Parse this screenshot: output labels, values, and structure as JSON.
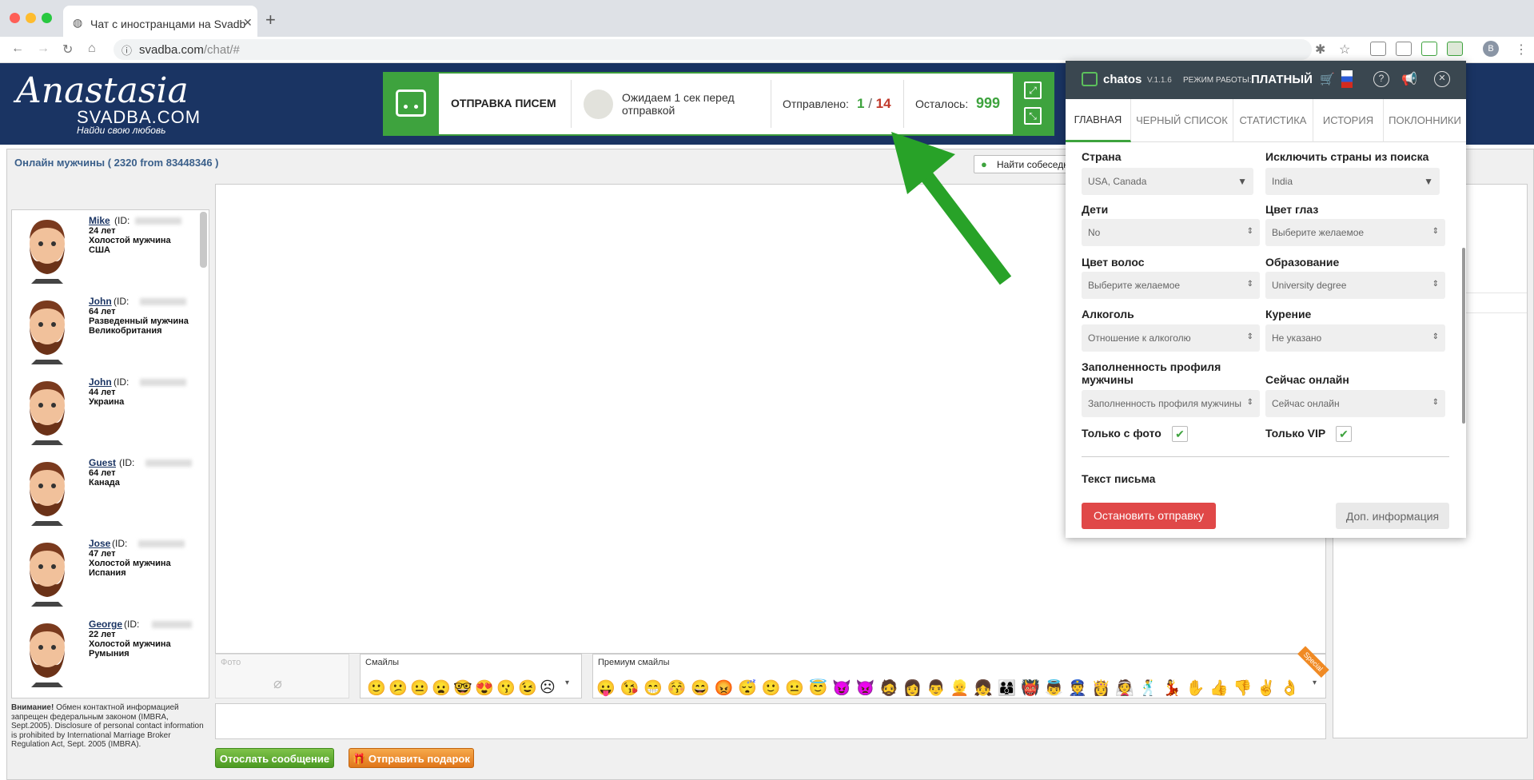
{
  "browser": {
    "tab_title": "Чат с иностранцами на Svadb",
    "url_host": "svadba.com",
    "url_path": "/chat/#",
    "profile_letter": "B"
  },
  "site": {
    "logo_script": "Anastasia",
    "logo_name": "SVADBA.COM",
    "logo_tagline": "Найди свою любовь"
  },
  "status_bar": {
    "title": "ОТПРАВКА ПИСЕМ",
    "waiting": "Ожидаем 1 сек перед отправкой",
    "sent_label": "Отправлено:",
    "sent_current": "1",
    "sent_sep": "/",
    "sent_total": "14",
    "left_label": "Осталось:",
    "left_value": "999"
  },
  "online": {
    "title": "Онлайн мужчины ( 2320 from 83448346 )",
    "find_button": "Найти собеседн"
  },
  "users": [
    {
      "name": "Mike",
      "id_label": "(ID: ",
      "age": "24 лет",
      "status": "Холостой мужчина",
      "country": "США"
    },
    {
      "name": "John",
      "id_label": " (ID: ",
      "age": "64 лет",
      "status": "Разведенный мужчина",
      "country": "Великобритания"
    },
    {
      "name": "John",
      "id_label": " (ID: ",
      "age": "44 лет",
      "status": "",
      "country": "Украина"
    },
    {
      "name": "Guest",
      "id_label": " (ID: ",
      "age": "64 лет",
      "status": "",
      "country": "Канада"
    },
    {
      "name": "Jose",
      "id_label": " (ID: ",
      "age": "47 лет",
      "status": "Холостой мужчина",
      "country": "Испания"
    },
    {
      "name": "George",
      "id_label": " (ID: ",
      "age": "22 лет",
      "status": "Холостой мужчина",
      "country": "Румыния"
    }
  ],
  "composer": {
    "photo_label": "Фото",
    "smiles_label": "Смайлы",
    "premium_label": "Премиум смайлы",
    "special_badge": "Special",
    "warning_bold": "Внимание!",
    "warning_text": " Обмен контактной информацией запрещен федеральным законом (IMBRA, Sept.2005). Disclosure of personal contact information is prohibited by International Marriage Broker Regulation Act, Sept. 2005 (IMBRA).",
    "send_button": "Отослать сообщение",
    "gift_button": "Отправить подарок",
    "smiles": [
      "🙂",
      "😕",
      "😐",
      "😦",
      "🤓",
      "😍",
      "😗",
      "😉",
      "☹"
    ],
    "premium_smiles": [
      "😛",
      "😘",
      "😁",
      "😚",
      "😄",
      "😡",
      "😴",
      "🙂",
      "😐",
      "😇",
      "😈",
      "👿",
      "🧔",
      "👩",
      "👨",
      "👱",
      "👧",
      "👨‍👩‍👦",
      "👹",
      "👼",
      "👮",
      "👸",
      "👰",
      "🕺",
      "💃",
      "✋",
      "👍",
      "👎",
      "✌",
      "👌"
    ]
  },
  "chatos": {
    "name": "chatos",
    "version": "V.1.1.6",
    "mode_label": "РЕЖИМ РАБОТЫ:",
    "mode_value": "ПЛАТНЫЙ",
    "tabs": [
      "ГЛАВНАЯ",
      "ЧЕРНЫЙ СПИСОК",
      "СТАТИСТИКА",
      "ИСТОРИЯ",
      "ПОКЛОННИКИ"
    ],
    "fields": {
      "country_label": "Страна",
      "country_value": "USA, Canada",
      "exclude_label": "Исключить страны из поиска",
      "exclude_value": "India",
      "kids_label": "Дети",
      "kids_value": "No",
      "eyes_label": "Цвет глаз",
      "eyes_value": "Выберите желаемое",
      "hair_label": "Цвет волос",
      "hair_value": "Выберите желаемое",
      "edu_label": "Образование",
      "edu_value": "University degree",
      "alcohol_label": "Алкоголь",
      "alcohol_value": "Отношение к алкоголю",
      "smoke_label": "Курение",
      "smoke_value": "Не указано",
      "profile_label": "Заполненность профиля мужчины",
      "profile_value": "Заполненность профиля мужчины",
      "online_label": "Сейчас онлайн",
      "online_value": "Сейчас онлайн",
      "photo_only_label": "Только с фото",
      "vip_only_label": "Только VIP",
      "letter_label": "Текст письма"
    },
    "stop_button": "Остановить отправку",
    "info_button": "Доп. информация"
  },
  "colors": {
    "accent_green": "#3ea33e",
    "header_navy": "#1a3463",
    "stop_red": "#e04848",
    "sent_total_red": "#c0392b"
  }
}
